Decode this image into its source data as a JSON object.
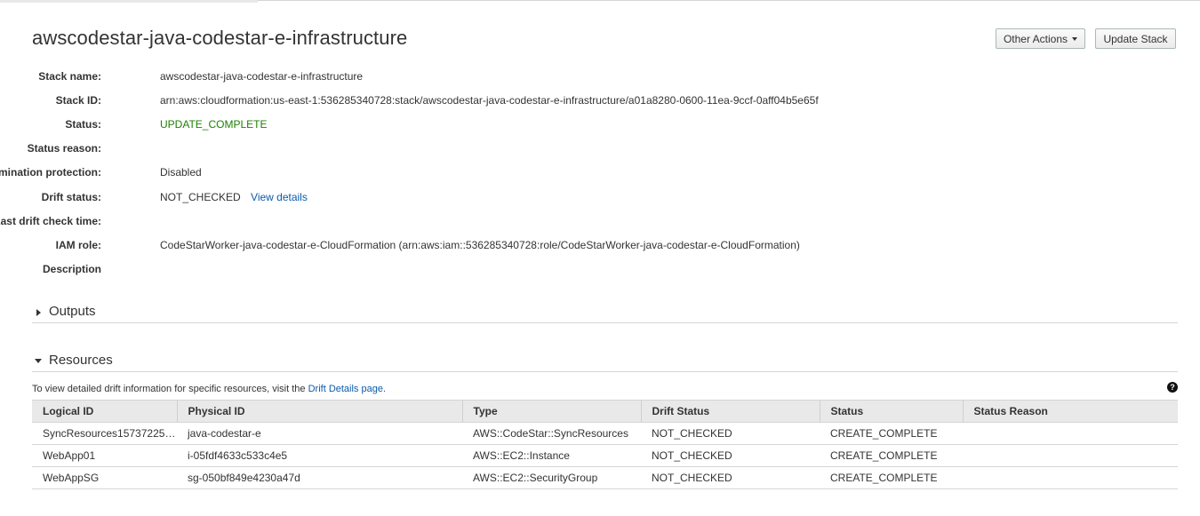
{
  "header": {
    "title": "awscodestar-java-codestar-e-infrastructure",
    "other_actions_label": "Other Actions",
    "update_stack_label": "Update Stack"
  },
  "details": [
    {
      "label": "Stack name:",
      "value": "awscodestar-java-codestar-e-infrastructure"
    },
    {
      "label": "Stack ID:",
      "value": "arn:aws:cloudformation:us-east-1:536285340728:stack/awscodestar-java-codestar-e-infrastructure/a01a8280-0600-11ea-9ccf-0aff04b5e65f"
    },
    {
      "label": "Status:",
      "value": "UPDATE_COMPLETE"
    },
    {
      "label": "Status reason:",
      "value": ""
    },
    {
      "label": "Termination protection:",
      "value": "Disabled"
    },
    {
      "label": "Drift status:",
      "value": "NOT_CHECKED",
      "link": "View details"
    },
    {
      "label": "Last drift check time:",
      "value": ""
    },
    {
      "label": "IAM role:",
      "value": "CodeStarWorker-java-codestar-e-CloudFormation (arn:aws:iam::536285340728:role/CodeStarWorker-java-codestar-e-CloudFormation)"
    },
    {
      "label": "Description",
      "value": ""
    }
  ],
  "outputs": {
    "title": "Outputs"
  },
  "resources": {
    "title": "Resources",
    "note_prefix": "To view detailed drift information for specific resources, visit the",
    "note_link": "Drift Details page.",
    "help_glyph": "?",
    "columns": [
      "Logical ID",
      "Physical ID",
      "Type",
      "Drift Status",
      "Status",
      "Status Reason"
    ],
    "rows": [
      {
        "logical_id": "SyncResources157372252...",
        "physical_id": "java-codestar-e",
        "physical_is_link": false,
        "type": "AWS::CodeStar::SyncResources",
        "drift_status": "NOT_CHECKED",
        "status": "CREATE_COMPLETE",
        "status_reason": ""
      },
      {
        "logical_id": "WebApp01",
        "physical_id": "i-05fdf4633c533c4e5",
        "physical_is_link": true,
        "type": "AWS::EC2::Instance",
        "drift_status": "NOT_CHECKED",
        "status": "CREATE_COMPLETE",
        "status_reason": ""
      },
      {
        "logical_id": "WebAppSG",
        "physical_id": "sg-050bf849e4230a47d",
        "physical_is_link": false,
        "type": "AWS::EC2::SecurityGroup",
        "drift_status": "NOT_CHECKED",
        "status": "CREATE_COMPLETE",
        "status_reason": ""
      }
    ]
  },
  "colors": {
    "status_green": "#1d8102",
    "link_blue": "#0a5bab"
  }
}
